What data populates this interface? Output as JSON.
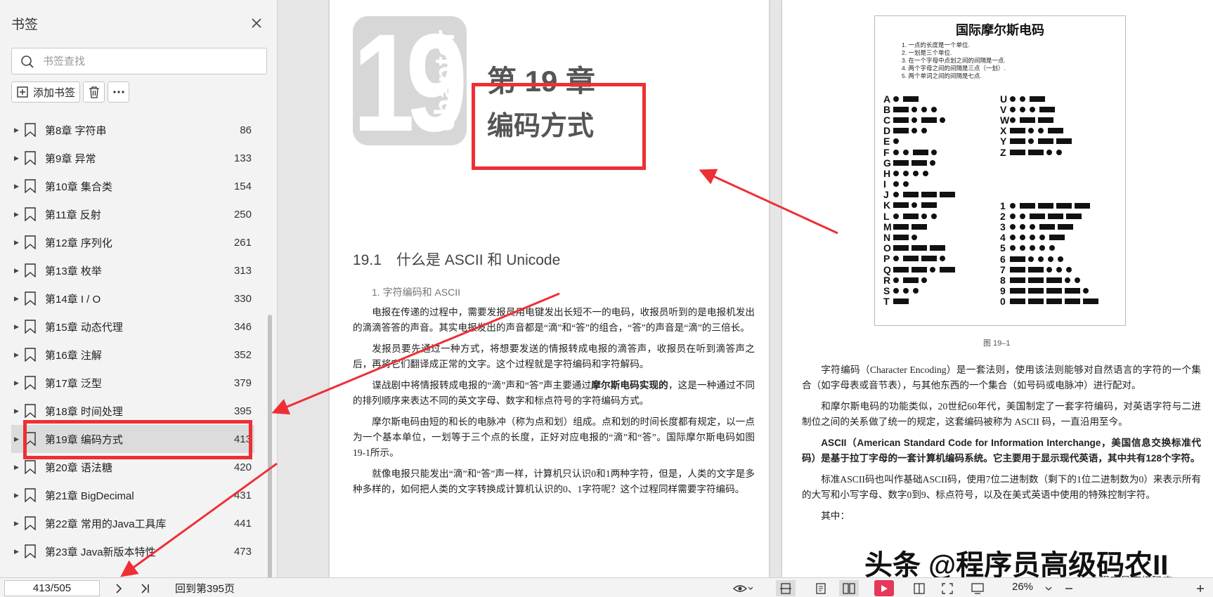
{
  "sidebar": {
    "title": "书签",
    "search_placeholder": "书签查找",
    "add_label": "添加书签",
    "items": [
      {
        "label": "第8章 字符串",
        "page": "86"
      },
      {
        "label": "第9章 异常",
        "page": "133"
      },
      {
        "label": "第10章 集合类",
        "page": "154"
      },
      {
        "label": "第11章 反射",
        "page": "250"
      },
      {
        "label": "第12章 序列化",
        "page": "261"
      },
      {
        "label": "第13章 枚举",
        "page": "313"
      },
      {
        "label": "第14章 I / O",
        "page": "330"
      },
      {
        "label": "第15章 动态代理",
        "page": "346"
      },
      {
        "label": "第16章 注解",
        "page": "352"
      },
      {
        "label": "第17章 泛型",
        "page": "379"
      },
      {
        "label": "第18章 时间处理",
        "page": "395"
      },
      {
        "label": "第19章 编码方式",
        "page": "413"
      },
      {
        "label": "第20章 语法糖",
        "page": "420"
      },
      {
        "label": "第21章 BigDecimal",
        "page": "431"
      },
      {
        "label": "第22章 常用的Java工具库",
        "page": "441"
      },
      {
        "label": "第23章 Java新版本特性",
        "page": "473"
      }
    ]
  },
  "left_page": {
    "chapter_number": "19",
    "chapter_word": "chapter",
    "chapter_title": "第 19 章",
    "chapter_name": "编码方式",
    "section_heading": "19.1　什么是 ASCII 和 Unicode",
    "subheading": "1. 字符编码和 ASCII",
    "p1": "电报在传递的过程中，需要发报员用电键发出长短不一的电码，收报员听到的是电报机发出的滴滴答答的声音。其实电报发出的声音都是“滴”和“答”的组合，“答”的声音是“滴”的三倍长。",
    "p2": "发报员要先通过一种方式，将想要发送的情报转成电报的滴答声，收报员在听到滴答声之后，再将它们翻译成正常的文字。这个过程就是字符编码和字符解码。",
    "p3a": "谍战剧中将情报转成电报的“滴”声和“答”声主要通过",
    "p3b": "摩尔斯电码实现的",
    "p3c": "，这是一种通过不同的排列顺序来表达不同的英文字母、数字和标点符号的字符编码方式。",
    "p4": "摩尔斯电码由短的和长的电脉冲（称为点和划）组成。点和划的时间长度都有规定，以一点为一个基本单位，一划等于三个点的长度，正好对应电报的“滴”和“答”。国际摩尔斯电码如图19-1所示。",
    "p5": "就像电报只能发出“滴”和“答”声一样，计算机只认识0和1两种字符，但是，人类的文字是多种多样的，如何把人类的文字转换成计算机认识的0、1字符呢？这个过程同样需要字符编码。"
  },
  "right_page": {
    "morse_title": "国际摩尔斯电码",
    "rules": [
      "1. 一点的长度是一个单位.",
      "2. 一划是三个单位.",
      "3. 在一个字母中点划之间的间隔是一点.",
      "4. 两个字母之间的间隔是三点（一划）.",
      "5. 两个单词之间的间隔是七点."
    ],
    "morse_letters_a": [
      {
        "ch": "A",
        "code": ".-"
      },
      {
        "ch": "B",
        "code": "-..."
      },
      {
        "ch": "C",
        "code": "-.-."
      },
      {
        "ch": "D",
        "code": "-.."
      },
      {
        "ch": "E",
        "code": "."
      },
      {
        "ch": "F",
        "code": "..-."
      },
      {
        "ch": "G",
        "code": "--."
      },
      {
        "ch": "H",
        "code": "...."
      },
      {
        "ch": "I",
        "code": ".."
      },
      {
        "ch": "J",
        "code": ".---"
      },
      {
        "ch": "K",
        "code": "-.-"
      },
      {
        "ch": "L",
        "code": ".-.."
      },
      {
        "ch": "M",
        "code": "--"
      },
      {
        "ch": "N",
        "code": "-."
      },
      {
        "ch": "O",
        "code": "---"
      },
      {
        "ch": "P",
        "code": ".--."
      },
      {
        "ch": "Q",
        "code": "--.-"
      },
      {
        "ch": "R",
        "code": ".-."
      },
      {
        "ch": "S",
        "code": "..."
      },
      {
        "ch": "T",
        "code": "-"
      }
    ],
    "morse_letters_b": [
      {
        "ch": "U",
        "code": "..-"
      },
      {
        "ch": "V",
        "code": "...-"
      },
      {
        "ch": "W",
        "code": ".--"
      },
      {
        "ch": "X",
        "code": "-..-"
      },
      {
        "ch": "Y",
        "code": "-.--"
      },
      {
        "ch": "Z",
        "code": "--.."
      }
    ],
    "morse_digits": [
      {
        "ch": "1",
        "code": ".----"
      },
      {
        "ch": "2",
        "code": "..---"
      },
      {
        "ch": "3",
        "code": "...--"
      },
      {
        "ch": "4",
        "code": "....-"
      },
      {
        "ch": "5",
        "code": "....."
      },
      {
        "ch": "6",
        "code": "-...."
      },
      {
        "ch": "7",
        "code": "--..."
      },
      {
        "ch": "8",
        "code": "---.."
      },
      {
        "ch": "9",
        "code": "----."
      },
      {
        "ch": "0",
        "code": "-----"
      }
    ],
    "figure_caption": "图 19–1",
    "p1": "字符编码（Character Encoding）是一套法则，使用该法则能够对自然语言的字符的一个集合（如字母表或音节表），与其他东西的一个集合（如号码或电脉冲）进行配对。",
    "p2": "和摩尔斯电码的功能类似，20世纪60年代，美国制定了一套字符编码，对英语字符与二进制位之间的关系做了统一的规定，这套编码被称为 ASCII 码，一直沿用至今。",
    "p3": "ASCII（American Standard Code for Information Interchange，美国信息交换标准代码）是基于拉丁字母的一套计算机编码系统。它主要用于显示现代英语，其中共有128个字符。",
    "p4": "标准ASCII码也叫作基础ASCII码，使用7位二进制数（剩下的1位二进制数为0）来表示所有的大写和小写字母、数字0到9、标点符号，以及在美式英语中使用的特殊控制字符。",
    "p5": "其中：",
    "watermark": "头条 @程序员高级码农II",
    "watermark_small": "CSDN @程序员高级码农"
  },
  "statusbar": {
    "page_indicator": "413/505",
    "back_label": "回到第395页",
    "zoom": "26%"
  },
  "colors": {
    "highlight": "#ee2f36",
    "record_button": "#e5385a"
  }
}
